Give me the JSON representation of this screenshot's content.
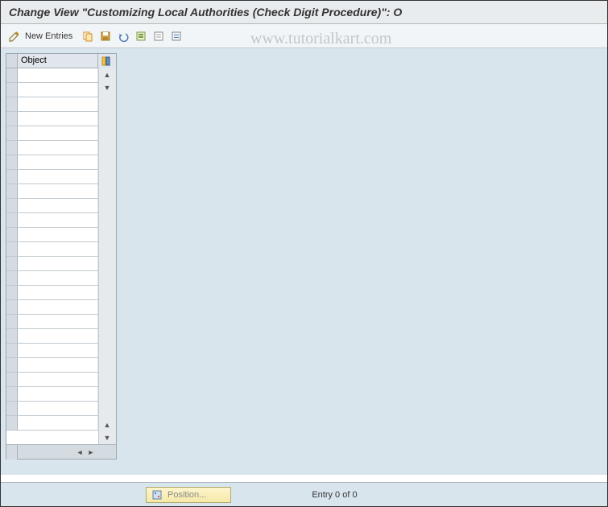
{
  "title": "Change View \"Customizing Local Authorities (Check Digit Procedure)\": O",
  "toolbar": {
    "new_entries_label": "New Entries"
  },
  "table": {
    "column_header": "Object",
    "rows": [
      "",
      "",
      "",
      "",
      "",
      "",
      "",
      "",
      "",
      "",
      "",
      "",
      "",
      "",
      "",
      "",
      "",
      "",
      "",
      "",
      "",
      "",
      "",
      "",
      ""
    ]
  },
  "status": {
    "position_label": "Position...",
    "entry_label": "Entry 0 of 0"
  },
  "watermark": "www.tutorialkart.com"
}
